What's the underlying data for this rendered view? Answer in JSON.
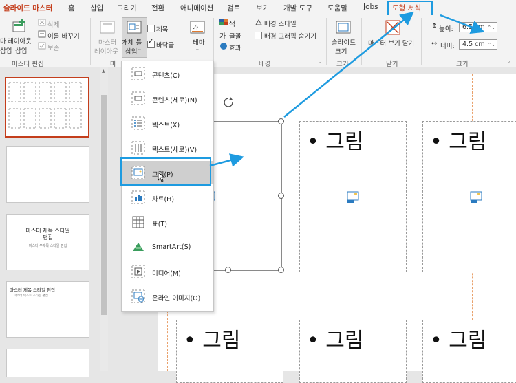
{
  "tabs": [
    "슬라이드 마스터",
    "홈",
    "삽입",
    "그리기",
    "전환",
    "애니메이션",
    "검토",
    "보기",
    "개발 도구",
    "도움말",
    "Jobs",
    "도형 서식"
  ],
  "ribbon": {
    "master_edit": {
      "insert_layout_top": "마",
      "insert_layout_bottom": "삽입",
      "layout_top": "레이아웃",
      "layout_bottom": "삽입",
      "delete": "삭제",
      "rename": "이름 바꾸기",
      "preserve": "보존",
      "label": "마스터 편집"
    },
    "master_layout": {
      "master_top": "마스터",
      "master_bottom": "레이아웃",
      "insert_ph_top": "개체 틀",
      "insert_ph_bottom": "삽입",
      "title_cb": "제목",
      "footer_cb": "바닥글",
      "label": "마"
    },
    "edit_theme": {
      "theme": "테마"
    },
    "background": {
      "colors": "색",
      "fonts": "글꼴",
      "effects": "효과",
      "bg_styles": "배경 스타일",
      "hide_bg": "배경 그래픽 숨기기",
      "label": "배경"
    },
    "size": {
      "slide_size_top": "슬라이드",
      "slide_size_bottom": "크기",
      "label": "크기"
    },
    "close": {
      "close_view": "마스터 보기 닫기",
      "label": "닫기"
    },
    "shape_size": {
      "height_label": "높이:",
      "height_value": "6.5 cm",
      "width_label": "너비:",
      "width_value": "4.5 cm",
      "label": "크기"
    }
  },
  "menu_items": [
    {
      "label": "콘텐츠(C)",
      "icon": "content-icon"
    },
    {
      "label": "콘텐츠(세로)(N)",
      "icon": "content-vertical-icon"
    },
    {
      "label": "텍스트(X)",
      "icon": "text-icon"
    },
    {
      "label": "텍스트(세로)(V)",
      "icon": "text-vertical-icon"
    },
    {
      "label": "그림(P)",
      "icon": "picture-icon"
    },
    {
      "label": "차트(H)",
      "icon": "chart-icon"
    },
    {
      "label": "표(T)",
      "icon": "table-icon"
    },
    {
      "label": "SmartArt(S)",
      "icon": "smartart-icon"
    },
    {
      "label": "미디어(M)",
      "icon": "media-icon"
    },
    {
      "label": "온라인 이미지(O)",
      "icon": "online-image-icon"
    }
  ],
  "slide": {
    "placeholder_text": "• 그림",
    "partial_text": "림"
  },
  "thumbs": {
    "t3_title_line1": "마스터 제목 스타일",
    "t3_title_line2": "편집",
    "t3_sub": "마스터 부제목 스타일 편집",
    "t4_title": "마스터 제목 스타일 편집",
    "t4_sub": "마스터 텍스트 스타일 편집"
  },
  "colors": {
    "accent": "#c43e1c",
    "highlight": "#1e9be0"
  }
}
